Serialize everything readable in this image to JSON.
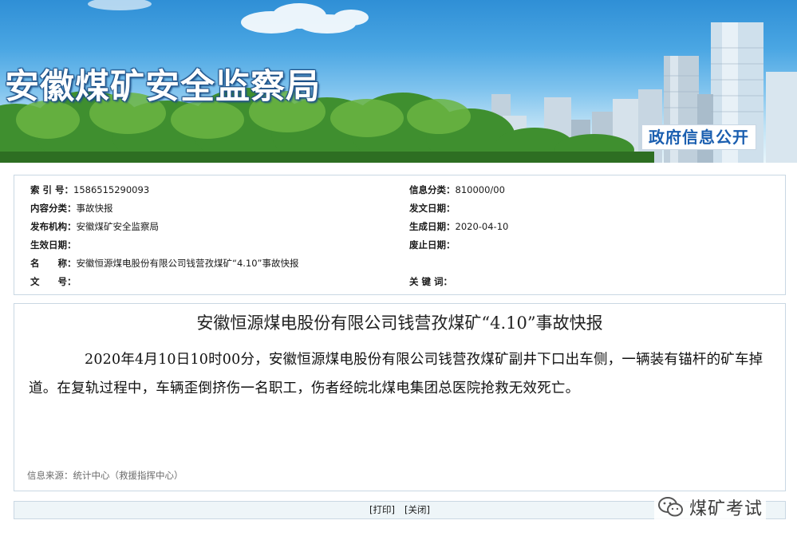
{
  "banner": {
    "title": "安徽煤矿安全监察局",
    "badge": "政府信息公开"
  },
  "info": {
    "left": [
      {
        "label": "索 引 号：",
        "value": "1586515290093"
      },
      {
        "label": "内容分类：",
        "value": "事故快报"
      },
      {
        "label": "发布机构：",
        "value": "安徽煤矿安全监察局"
      },
      {
        "label": "生效日期：",
        "value": ""
      },
      {
        "label": "名　　称：",
        "value": "安徽恒源煤电股份有限公司钱营孜煤矿“4.10”事故快报"
      },
      {
        "label": "文　　号：",
        "value": ""
      }
    ],
    "right": [
      {
        "label": "信息分类：",
        "value": "810000/00"
      },
      {
        "label": "发文日期：",
        "value": ""
      },
      {
        "label": "生成日期：",
        "value": "2020-04-10"
      },
      {
        "label": "废止日期：",
        "value": ""
      },
      {
        "label": "关 键 词：",
        "value": ""
      }
    ]
  },
  "article": {
    "title": "安徽恒源煤电股份有限公司钱营孜煤矿“4.10”事故快报",
    "body": "2020年4月10日10时00分，安徽恒源煤电股份有限公司钱营孜煤矿副井下口出车侧，一辆装有锚杆的矿车掉道。在复轨过程中，车辆歪倒挤伤一名职工，伤者经皖北煤电集团总医院抢救无效死亡。",
    "source": "信息来源：统计中心（救援指挥中心）"
  },
  "actions": {
    "print": "[打印]",
    "close": "[关闭]"
  },
  "watermark": {
    "icon": "wechat-icon",
    "text": "煤矿考试"
  },
  "colors": {
    "badge_text": "#1b5fb0",
    "border": "#c9d7e3",
    "bar_bg": "#eef5f8"
  }
}
